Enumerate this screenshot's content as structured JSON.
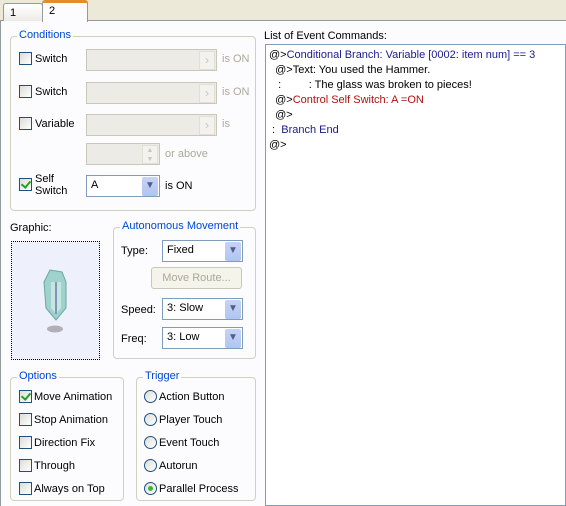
{
  "tabs": [
    {
      "label": "1"
    },
    {
      "label": "2",
      "active": true
    }
  ],
  "conditions": {
    "title": "Conditions",
    "switch1": {
      "label": "Switch",
      "checked": false,
      "value": "",
      "suffix": "is ON"
    },
    "switch2": {
      "label": "Switch",
      "checked": false,
      "value": "",
      "suffix": "is ON"
    },
    "variable": {
      "label": "Variable",
      "checked": false,
      "value": "",
      "suffix": "is",
      "number": "",
      "number_suffix": "or above"
    },
    "self_switch": {
      "label_line1": "Self",
      "label_line2": "Switch",
      "checked": true,
      "value": "A",
      "suffix": "is ON"
    }
  },
  "graphic": {
    "label": "Graphic:"
  },
  "movement": {
    "title": "Autonomous Movement",
    "type_label": "Type:",
    "type_value": "Fixed",
    "move_route": "Move Route...",
    "speed_label": "Speed:",
    "speed_value": "3: Slow",
    "freq_label": "Freq:",
    "freq_value": "3: Low"
  },
  "options": {
    "title": "Options",
    "items": [
      {
        "label": "Move Animation",
        "checked": true
      },
      {
        "label": "Stop Animation",
        "checked": false
      },
      {
        "label": "Direction Fix",
        "checked": false
      },
      {
        "label": "Through",
        "checked": false
      },
      {
        "label": "Always on Top",
        "checked": false
      }
    ]
  },
  "trigger": {
    "title": "Trigger",
    "items": [
      {
        "label": "Action Button",
        "selected": false
      },
      {
        "label": "Player Touch",
        "selected": false
      },
      {
        "label": "Event Touch",
        "selected": false
      },
      {
        "label": "Autorun",
        "selected": false
      },
      {
        "label": "Parallel Process",
        "selected": true
      }
    ]
  },
  "commands": {
    "label": "List of Event Commands:",
    "lines": [
      {
        "prefix": "@>",
        "text": "Conditional Branch: Variable [0002: item num] == 3",
        "color": "#1a1a8c"
      },
      {
        "prefix": "  @>",
        "text": "Text: You used the Hammer.",
        "color": "#000000"
      },
      {
        "prefix": "   :         ",
        "text": ": The glass was broken to pieces!",
        "color": "#000000"
      },
      {
        "prefix": "  @>",
        "text": "Control Self Switch: A =ON",
        "color": "#b01010"
      },
      {
        "prefix": "  @>",
        "text": "",
        "color": "#000000"
      },
      {
        "prefix": " :  ",
        "text": "Branch End",
        "color": "#1a1a8c"
      },
      {
        "prefix": "@>",
        "text": "",
        "color": "#000000"
      }
    ]
  }
}
